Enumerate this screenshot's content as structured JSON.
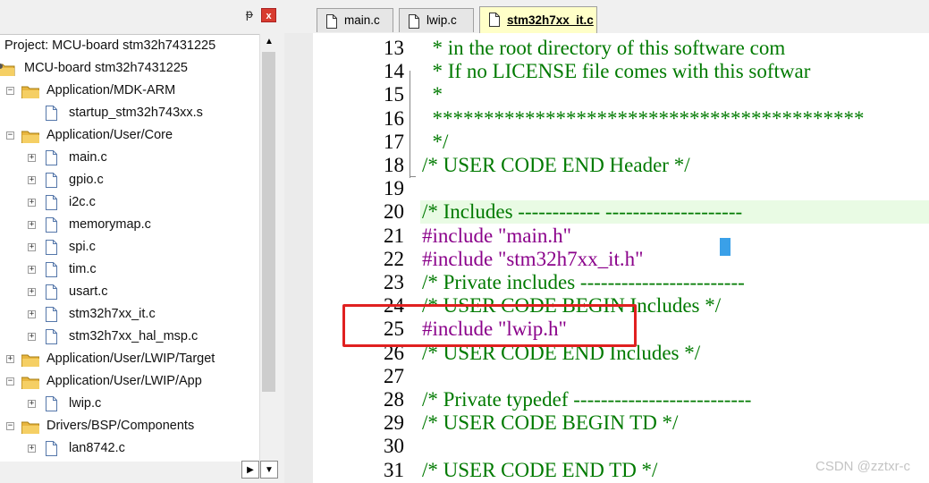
{
  "project_panel": {
    "pin_glyph": "ᵽ",
    "close_glyph": "x",
    "root_label": "Project: MCU-board stm32h7431225",
    "tree": [
      {
        "label": "MCU-board stm32h7431225",
        "type": "target"
      },
      {
        "label": "Application/MDK-ARM",
        "type": "folder",
        "expander": "−"
      },
      {
        "label": "startup_stm32h743xx.s",
        "type": "file"
      },
      {
        "label": "Application/User/Core",
        "type": "folder",
        "expander": "−"
      },
      {
        "label": "main.c",
        "type": "file",
        "expander": "+"
      },
      {
        "label": "gpio.c",
        "type": "file",
        "expander": "+"
      },
      {
        "label": "i2c.c",
        "type": "file",
        "expander": "+"
      },
      {
        "label": "memorymap.c",
        "type": "file",
        "expander": "+"
      },
      {
        "label": "spi.c",
        "type": "file",
        "expander": "+"
      },
      {
        "label": "tim.c",
        "type": "file",
        "expander": "+"
      },
      {
        "label": "usart.c",
        "type": "file",
        "expander": "+"
      },
      {
        "label": "stm32h7xx_it.c",
        "type": "file",
        "expander": "+"
      },
      {
        "label": "stm32h7xx_hal_msp.c",
        "type": "file",
        "expander": "+"
      },
      {
        "label": "Application/User/LWIP/Target",
        "type": "folder",
        "expander": "+"
      },
      {
        "label": "Application/User/LWIP/App",
        "type": "folder",
        "expander": "−"
      },
      {
        "label": "lwip.c",
        "type": "file",
        "expander": "+"
      },
      {
        "label": "Drivers/BSP/Components",
        "type": "folder",
        "expander": "−"
      },
      {
        "label": "lan8742.c",
        "type": "file",
        "expander": "+"
      }
    ],
    "scroll": {
      "up": "▲",
      "right": "▶",
      "down": "▼"
    }
  },
  "tabs": [
    {
      "label": "main.c",
      "active": false
    },
    {
      "label": "lwip.c",
      "active": false
    },
    {
      "label": "stm32h7xx_it.c",
      "active": true
    }
  ],
  "code_lines": [
    {
      "num": "13",
      "text": "  * in the root directory of this software com",
      "color": "green"
    },
    {
      "num": "14",
      "text": "  * If no LICENSE file comes with this softwar",
      "color": "green"
    },
    {
      "num": "15",
      "text": "  *",
      "color": "green"
    },
    {
      "num": "16",
      "text": "  ******************************************",
      "color": "green"
    },
    {
      "num": "17",
      "text": "  */",
      "color": "green"
    },
    {
      "num": "18",
      "text": "/* USER CODE END Header */",
      "color": "green"
    },
    {
      "num": "19",
      "text": "",
      "color": "green"
    },
    {
      "num": "20",
      "text": "/* Includes ------------ --------------------",
      "color": "green",
      "highlight": true
    },
    {
      "num": "21",
      "text": "#include ",
      "include": "\"main.h\""
    },
    {
      "num": "22",
      "text": "#include ",
      "include": "\"stm32h7xx_it.h\""
    },
    {
      "num": "23",
      "text": "/* Private includes ------------------------",
      "color": "green"
    },
    {
      "num": "24",
      "text": "/* USER CODE BEGIN Includes */",
      "color": "green"
    },
    {
      "num": "25",
      "text": "#include ",
      "include": "\"lwip.h\""
    },
    {
      "num": "26",
      "text": "/* USER CODE END Includes */",
      "color": "green"
    },
    {
      "num": "27",
      "text": "",
      "color": "green"
    },
    {
      "num": "28",
      "text": "/* Private typedef --------------------------",
      "color": "green"
    },
    {
      "num": "29",
      "text": "/* USER CODE BEGIN TD */",
      "color": "green"
    },
    {
      "num": "30",
      "text": "",
      "color": "green"
    },
    {
      "num": "31",
      "text": "/* USER CODE END TD */",
      "color": "green"
    }
  ],
  "colors": {
    "comment": "#007a00",
    "string": "#8a008a",
    "highlight_box": "#e02020"
  },
  "watermark": "CSDN @zztxr-c"
}
